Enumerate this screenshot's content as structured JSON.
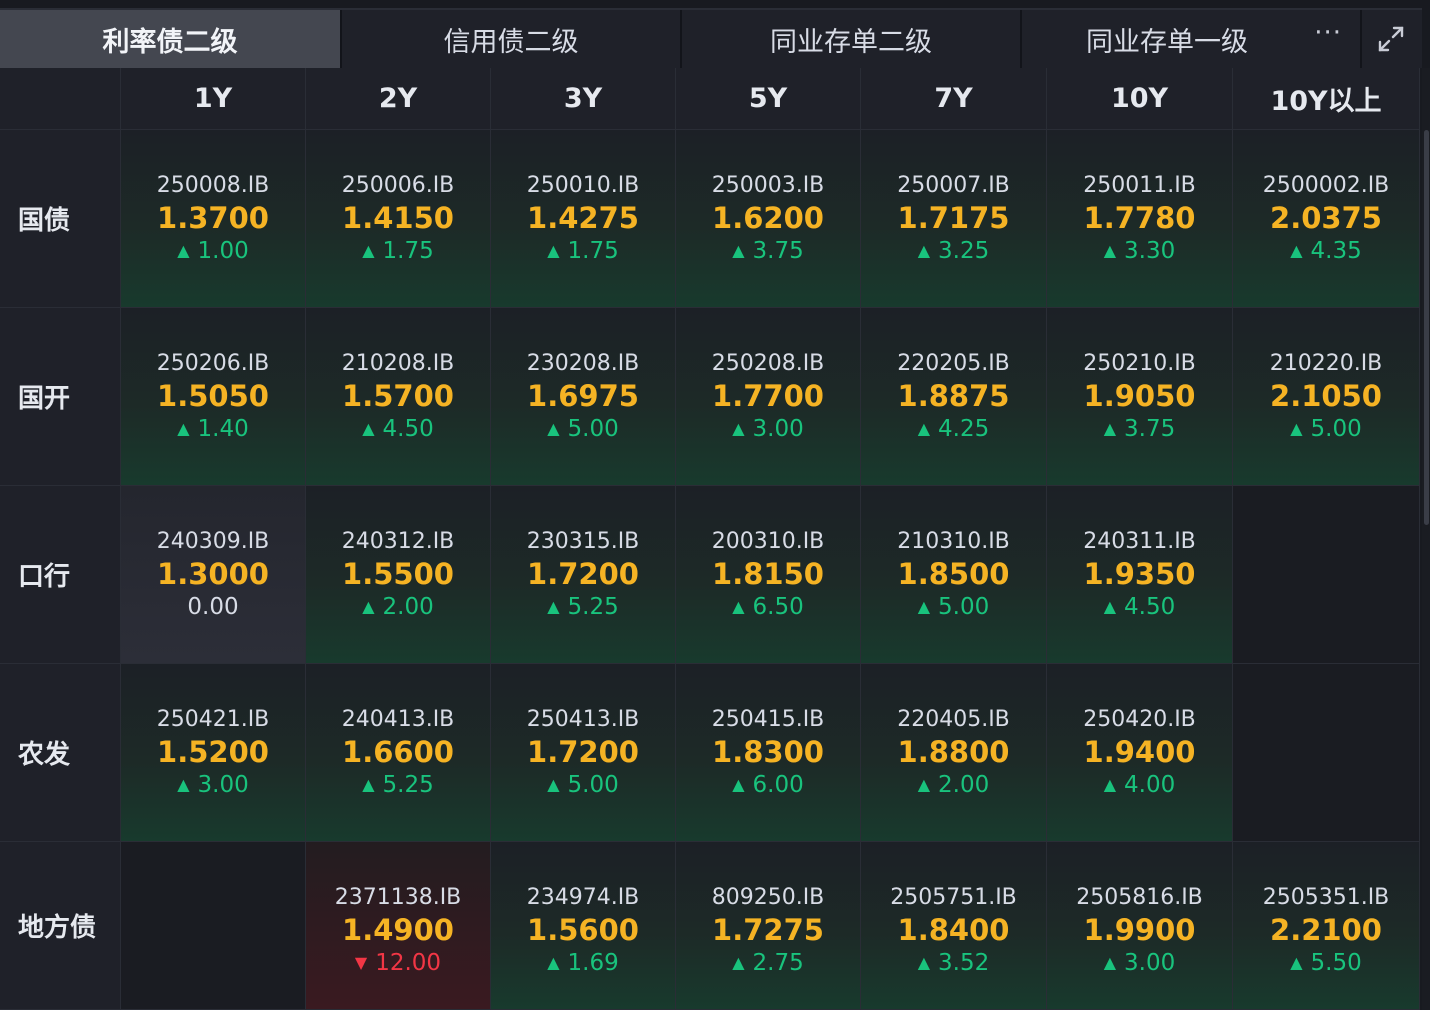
{
  "tabs": [
    {
      "label": "利率债二级",
      "active": true
    },
    {
      "label": "信用债二级",
      "active": false
    },
    {
      "label": "同业存单二级",
      "active": false
    },
    {
      "label": "同业存单一级",
      "active": false
    }
  ],
  "tab_more": "···",
  "columns": [
    "1Y",
    "2Y",
    "3Y",
    "5Y",
    "7Y",
    "10Y",
    "10Y以上"
  ],
  "rows": [
    {
      "label": "国债",
      "cells": [
        {
          "code": "250008.IB",
          "yield": "1.3700",
          "chg": "1.00",
          "dir": "up"
        },
        {
          "code": "250006.IB",
          "yield": "1.4150",
          "chg": "1.75",
          "dir": "up"
        },
        {
          "code": "250010.IB",
          "yield": "1.4275",
          "chg": "1.75",
          "dir": "up"
        },
        {
          "code": "250003.IB",
          "yield": "1.6200",
          "chg": "3.75",
          "dir": "up"
        },
        {
          "code": "250007.IB",
          "yield": "1.7175",
          "chg": "3.25",
          "dir": "up"
        },
        {
          "code": "250011.IB",
          "yield": "1.7780",
          "chg": "3.30",
          "dir": "up"
        },
        {
          "code": "2500002.IB",
          "yield": "2.0375",
          "chg": "4.35",
          "dir": "up"
        }
      ]
    },
    {
      "label": "国开",
      "cells": [
        {
          "code": "250206.IB",
          "yield": "1.5050",
          "chg": "1.40",
          "dir": "up"
        },
        {
          "code": "210208.IB",
          "yield": "1.5700",
          "chg": "4.50",
          "dir": "up"
        },
        {
          "code": "230208.IB",
          "yield": "1.6975",
          "chg": "5.00",
          "dir": "up"
        },
        {
          "code": "250208.IB",
          "yield": "1.7700",
          "chg": "3.00",
          "dir": "up"
        },
        {
          "code": "220205.IB",
          "yield": "1.8875",
          "chg": "4.25",
          "dir": "up"
        },
        {
          "code": "250210.IB",
          "yield": "1.9050",
          "chg": "3.75",
          "dir": "up"
        },
        {
          "code": "210220.IB",
          "yield": "2.1050",
          "chg": "5.00",
          "dir": "up"
        }
      ]
    },
    {
      "label": "口行",
      "cells": [
        {
          "code": "240309.IB",
          "yield": "1.3000",
          "chg": "0.00",
          "dir": "flat"
        },
        {
          "code": "240312.IB",
          "yield": "1.5500",
          "chg": "2.00",
          "dir": "up"
        },
        {
          "code": "230315.IB",
          "yield": "1.7200",
          "chg": "5.25",
          "dir": "up"
        },
        {
          "code": "200310.IB",
          "yield": "1.8150",
          "chg": "6.50",
          "dir": "up"
        },
        {
          "code": "210310.IB",
          "yield": "1.8500",
          "chg": "5.00",
          "dir": "up"
        },
        {
          "code": "240311.IB",
          "yield": "1.9350",
          "chg": "4.50",
          "dir": "up"
        },
        null
      ]
    },
    {
      "label": "农发",
      "cells": [
        {
          "code": "250421.IB",
          "yield": "1.5200",
          "chg": "3.00",
          "dir": "up"
        },
        {
          "code": "240413.IB",
          "yield": "1.6600",
          "chg": "5.25",
          "dir": "up"
        },
        {
          "code": "250413.IB",
          "yield": "1.7200",
          "chg": "5.00",
          "dir": "up"
        },
        {
          "code": "250415.IB",
          "yield": "1.8300",
          "chg": "6.00",
          "dir": "up"
        },
        {
          "code": "220405.IB",
          "yield": "1.8800",
          "chg": "2.00",
          "dir": "up"
        },
        {
          "code": "250420.IB",
          "yield": "1.9400",
          "chg": "4.00",
          "dir": "up"
        },
        null
      ]
    },
    {
      "label": "地方债",
      "cells": [
        null,
        {
          "code": "2371138.IB",
          "yield": "1.4900",
          "chg": "12.00",
          "dir": "down"
        },
        {
          "code": "234974.IB",
          "yield": "1.5600",
          "chg": "1.69",
          "dir": "up"
        },
        {
          "code": "809250.IB",
          "yield": "1.7275",
          "chg": "2.75",
          "dir": "up"
        },
        {
          "code": "2505751.IB",
          "yield": "1.8400",
          "chg": "3.52",
          "dir": "up"
        },
        {
          "code": "2505816.IB",
          "yield": "1.9900",
          "chg": "3.00",
          "dir": "up"
        },
        {
          "code": "2505351.IB",
          "yield": "2.2100",
          "chg": "5.50",
          "dir": "up"
        }
      ]
    }
  ],
  "colors": {
    "up": "#19c37d",
    "down": "#f23645",
    "yield": "#f5b324",
    "background": "#181a20",
    "active_tab": "#444750"
  },
  "icons": {
    "more": "ellipsis-icon",
    "expand": "expand-icon",
    "arrow_up": "triangle-up-icon",
    "arrow_down": "triangle-down-icon"
  }
}
